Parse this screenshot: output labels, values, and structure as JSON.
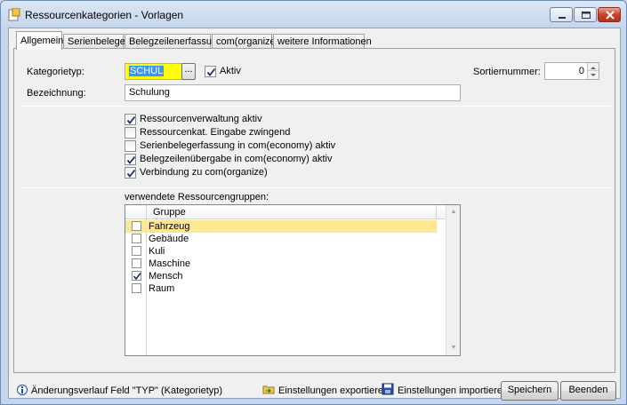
{
  "window": {
    "title": "Ressourcenkategorien - Vorlagen"
  },
  "tabs": [
    "Allgemein",
    "Serienbelege",
    "Belegzeilenerfassung",
    "com(organize)",
    "weitere Informationen"
  ],
  "form": {
    "kategorietyp_label": "Kategorietyp:",
    "kategorietyp_value": "SCHUL",
    "browse_label": "...",
    "aktiv_label": "Aktiv",
    "aktiv_checked": true,
    "bezeichnung_label": "Bezeichnung:",
    "bezeichnung_value": "Schulung",
    "sortiernummer_label": "Sortiernummer:",
    "sortiernummer_value": "0"
  },
  "options": [
    {
      "label": "Ressourcenverwaltung aktiv",
      "checked": true
    },
    {
      "label": "Ressourcenkat. Eingabe zwingend",
      "checked": false
    },
    {
      "label": "Serienbelegerfassung in com(economy) aktiv",
      "checked": false
    },
    {
      "label": "Belegzeilenübergabe in com(economy) aktiv",
      "checked": true
    },
    {
      "label": "Verbindung zu com(organize)",
      "checked": true
    }
  ],
  "groups": {
    "label": "verwendete Ressourcengruppen:",
    "column_header": "Gruppe",
    "rows": [
      {
        "name": "Fahrzeug",
        "checked": false,
        "selected": true
      },
      {
        "name": "Gebäude",
        "checked": false,
        "selected": false
      },
      {
        "name": "Kuli",
        "checked": false,
        "selected": false
      },
      {
        "name": "Maschine",
        "checked": false,
        "selected": false
      },
      {
        "name": "Mensch",
        "checked": true,
        "selected": false
      },
      {
        "name": "Raum",
        "checked": false,
        "selected": false
      }
    ]
  },
  "footer": {
    "info_text": "Änderungsverlauf Feld \"TYP\" (Kategorietyp)",
    "export_label": "Einstellungen exportieren",
    "import_label": "Einstellungen importieren",
    "save_label": "Speichern",
    "close_label": "Beenden"
  }
}
